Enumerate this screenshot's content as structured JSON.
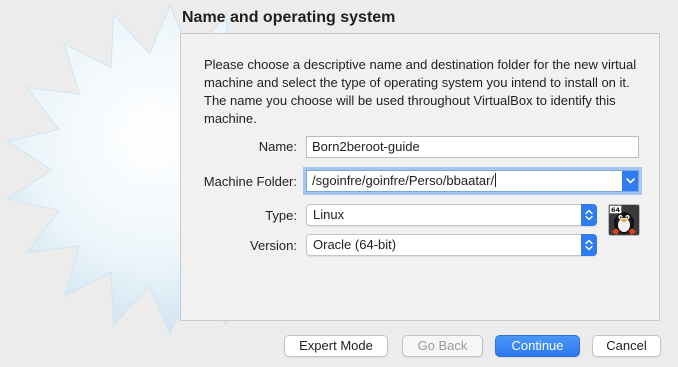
{
  "section_title": "Name and operating system",
  "description": "Please choose a descriptive name and destination folder for the new virtual machine and select the type of operating system you intend to install on it. The name you choose will be used throughout VirtualBox to identify this machine.",
  "fields": {
    "name": {
      "label": "Name:",
      "value": "Born2beroot-guide"
    },
    "machine_folder": {
      "label": "Machine Folder:",
      "value": "/sgoinfre/goinfre/Perso/bbaatar/"
    },
    "type": {
      "label": "Type:",
      "value": "Linux"
    },
    "version": {
      "label": "Version:",
      "value": "Oracle (64-bit)"
    }
  },
  "os_icon": {
    "name": "oracle-linux-64-icon",
    "badge": "64"
  },
  "buttons": {
    "expert_mode": "Expert Mode",
    "go_back": "Go Back",
    "continue": "Continue",
    "cancel": "Cancel"
  },
  "colors": {
    "accent": "#2f7bf0",
    "window_background": "#ececec",
    "panel_background": "#f1f1f1"
  }
}
